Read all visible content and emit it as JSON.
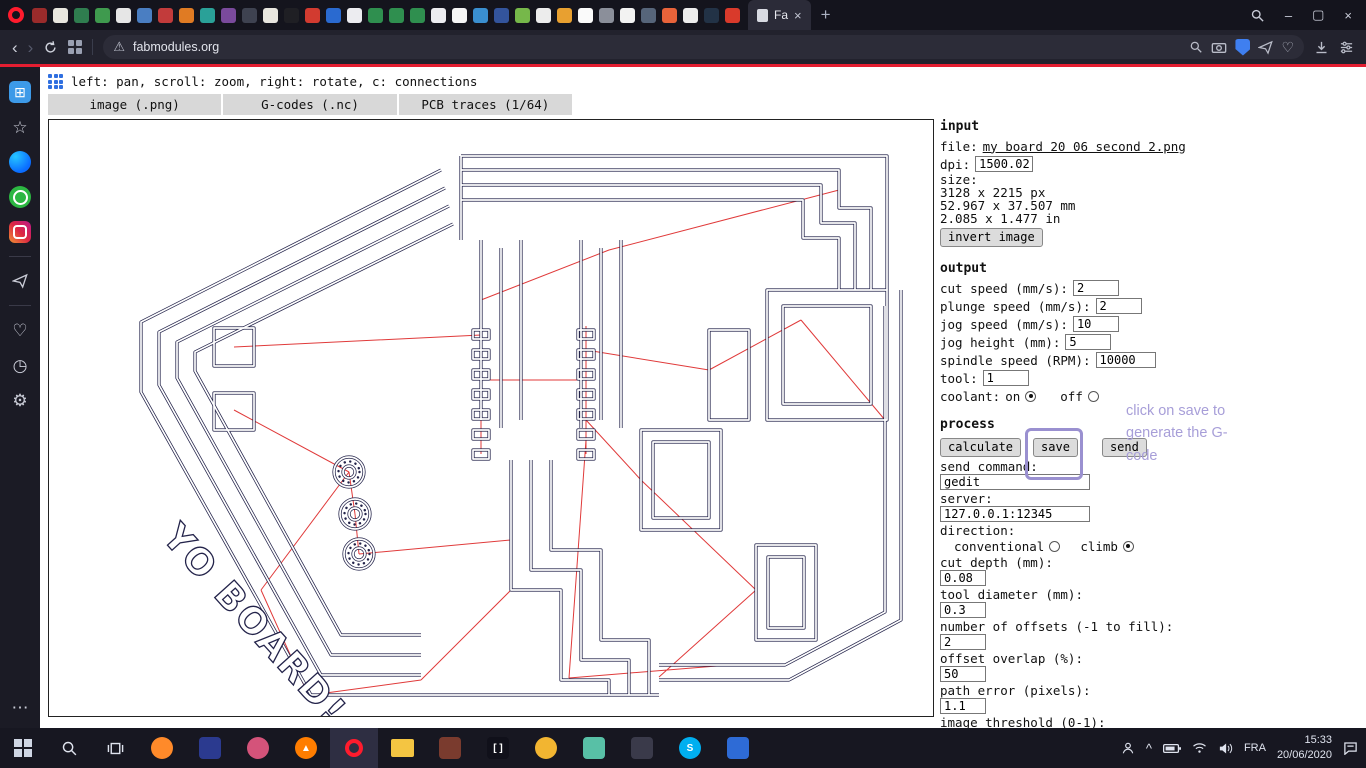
{
  "browser": {
    "active_tab": {
      "label": "Fa",
      "close": "×"
    },
    "new_tab_label": "+",
    "url": "fabmodules.org",
    "nav": {
      "back": "‹",
      "forward": "›"
    },
    "window_controls": {
      "minimize": "–",
      "maximize": "▢",
      "close": "×"
    },
    "favicon_colors": [
      "#9a2b2b",
      "#e8e6df",
      "#2f7d4f",
      "#3f9a4e",
      "#e6e6e6",
      "#4a7ec2",
      "#c23b3b",
      "#e07b23",
      "#2aa198",
      "#7a4a9c",
      "#3e4250",
      "#e8e6df",
      "#1f1f24",
      "#d23b30",
      "#2a6ad0",
      "#ececf0",
      "#2f8f4f",
      "#2f8f4f",
      "#2f8f4f",
      "#ececf0",
      "#f5f5f5",
      "#3a8fd0",
      "#33549c",
      "#76b84a",
      "#ececec",
      "#e8a030",
      "#fafafa",
      "#8b8f9a",
      "#f2f2f2",
      "#56657a",
      "#e8633a",
      "#ededed",
      "#223246",
      "#d93a2b"
    ]
  },
  "sidebar": {
    "items": [
      {
        "name": "speed-dial",
        "glyph": "⊞"
      },
      {
        "name": "bookmarks",
        "glyph": "☆"
      },
      {
        "name": "likes",
        "glyph": "♡"
      },
      {
        "name": "history",
        "glyph": "◷"
      },
      {
        "name": "settings",
        "glyph": "⚙"
      },
      {
        "name": "more",
        "glyph": "⋯"
      }
    ]
  },
  "page": {
    "hint": "left: pan, scroll: zoom, right: rotate, c: connections",
    "format_tabs": [
      "image (.png)",
      "G-codes (.nc)",
      "PCB traces (1/64)"
    ],
    "board_text": "YO BOARD!"
  },
  "input_panel": {
    "heading": "input",
    "file_label": "file:",
    "file_name": "my board 20 06 second 2.png",
    "dpi_label": "dpi:",
    "dpi_value": "1500.02",
    "size_label": "size:",
    "size_px": "3128 x 2215 px",
    "size_mm": "52.967 x 37.507 mm",
    "size_in": "2.085 x 1.477 in",
    "invert_button": "invert image"
  },
  "output_panel": {
    "heading": "output",
    "fields": [
      {
        "label": "cut speed (mm/s):",
        "value": "2"
      },
      {
        "label": "plunge speed (mm/s):",
        "value": "2"
      },
      {
        "label": "jog speed (mm/s):",
        "value": "10"
      },
      {
        "label": "jog height (mm):",
        "value": "5"
      },
      {
        "label": "spindle speed (RPM):",
        "value": "10000"
      },
      {
        "label": "tool:",
        "value": "1"
      }
    ],
    "coolant": {
      "label": "coolant:",
      "on": "on",
      "off": "off",
      "selected": "on"
    }
  },
  "process_panel": {
    "heading": "process",
    "buttons": {
      "calculate": "calculate",
      "save": "save",
      "send": "send"
    },
    "send_command_label": "send command:",
    "send_command_value": "gedit",
    "server_label": "server:",
    "server_value": "127.0.0.1:12345",
    "direction_label": "direction:",
    "direction": {
      "conventional": "conventional",
      "climb": "climb",
      "selected": "climb"
    },
    "fields": [
      {
        "label": "cut depth (mm):",
        "value": "0.08"
      },
      {
        "label": "tool diameter (mm):",
        "value": "0.3"
      },
      {
        "label": "number of offsets (-1 to fill):",
        "value": "2"
      },
      {
        "label": "offset overlap (%):",
        "value": "50"
      },
      {
        "label": "path error (pixels):",
        "value": "1.1"
      },
      {
        "label": "image threshold (0-1):",
        "value": ""
      }
    ]
  },
  "annotation": {
    "text": "click on save to generate the G-code"
  },
  "taskbar": {
    "apps": [
      {
        "name": "firefox",
        "color": "#ff8a2a",
        "shape": "circle"
      },
      {
        "name": "mail",
        "color": "#2b3a8f",
        "shape": "square"
      },
      {
        "name": "paint",
        "color": "#d4537a",
        "shape": "circle"
      },
      {
        "name": "vlc",
        "color": "#ff7d00",
        "shape": "circle",
        "glyph": "▲"
      },
      {
        "name": "opera",
        "color": "#ff1b2d",
        "shape": "ring",
        "active": true
      },
      {
        "name": "file-explorer",
        "color": "#f4c542",
        "shape": "folder"
      },
      {
        "name": "reader",
        "color": "#7a3b2e",
        "shape": "square"
      },
      {
        "name": "code",
        "color": "#10101a",
        "shape": "square",
        "glyph": "[ ]"
      },
      {
        "name": "chrome",
        "color": "#f2b531",
        "shape": "circle"
      },
      {
        "name": "photos",
        "color": "#58c0a6",
        "shape": "square"
      },
      {
        "name": "recorder",
        "color": "#3a3a4a",
        "shape": "square"
      },
      {
        "name": "skype",
        "color": "#00aff0",
        "shape": "circle",
        "glyph": "S"
      },
      {
        "name": "media",
        "color": "#2e6bd6",
        "shape": "square"
      }
    ],
    "tray": {
      "lang": "FRA",
      "time": "15:33",
      "date": "20/06/2020"
    }
  }
}
